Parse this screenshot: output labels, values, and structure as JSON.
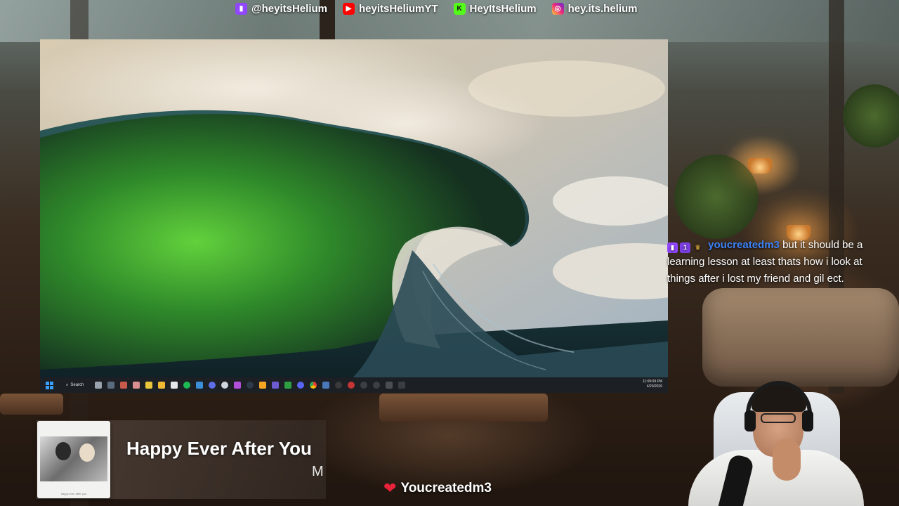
{
  "social_bar": [
    {
      "icon": "twitch-icon",
      "color": "#9146ff",
      "label": "@heyitsHelium"
    },
    {
      "icon": "youtube-icon",
      "color": "#ff0000",
      "label": "heyitsHeliumYT"
    },
    {
      "icon": "kick-icon",
      "color": "#53fc18",
      "label": "HeyItsHelium"
    },
    {
      "icon": "instagram-icon",
      "color": "#d62976",
      "label": "hey.its.helium"
    }
  ],
  "taskbar": {
    "search_label": "Search",
    "time": "11:09:09 PM",
    "date": "4/20/2026"
  },
  "chat": {
    "username": "youcreatedm3",
    "username_color": "#3b82f6",
    "message": "but it should be a learning lesson at least thats how i look at things after i lost my friend and gil ect."
  },
  "now_playing": {
    "title": "Happy Ever After You",
    "artist": "M",
    "album_caption": "happy ever after you"
  },
  "follower_alert": {
    "name": "Youcreatedm3"
  }
}
